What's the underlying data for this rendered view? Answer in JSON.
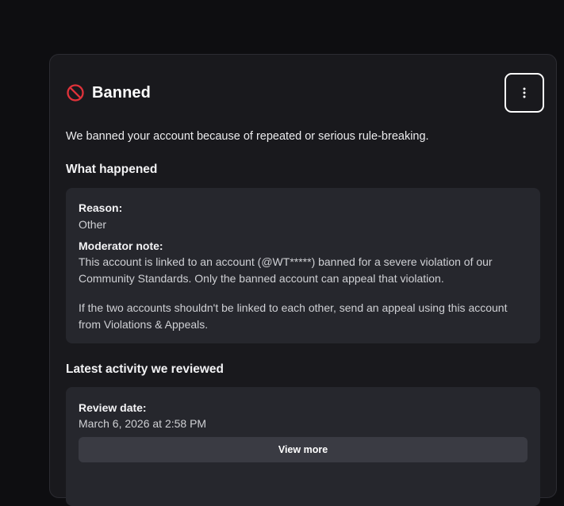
{
  "status": {
    "title": "Banned",
    "icon": "prohibited-icon",
    "icon_color": "#e0323a"
  },
  "menu": {
    "icon": "more-vertical-icon"
  },
  "intro_text": "We banned your account because of repeated or serious rule-breaking.",
  "what_happened": {
    "heading": "What happened",
    "reason_label": "Reason:",
    "reason_value": "Other",
    "note_label": "Moderator note:",
    "note_paragraph_1": "This account is linked to an account (@WT*****) banned for a severe violation of our Community Standards. Only the banned account can appeal that violation.",
    "note_paragraph_2": "If the two accounts shouldn't be linked to each other, send an appeal using this account from Violations & Appeals."
  },
  "latest_activity": {
    "heading": "Latest activity we reviewed",
    "review_date_label": "Review date:",
    "review_date_value": "March 6, 2026 at 2:58 PM",
    "view_more_label": "View more"
  }
}
